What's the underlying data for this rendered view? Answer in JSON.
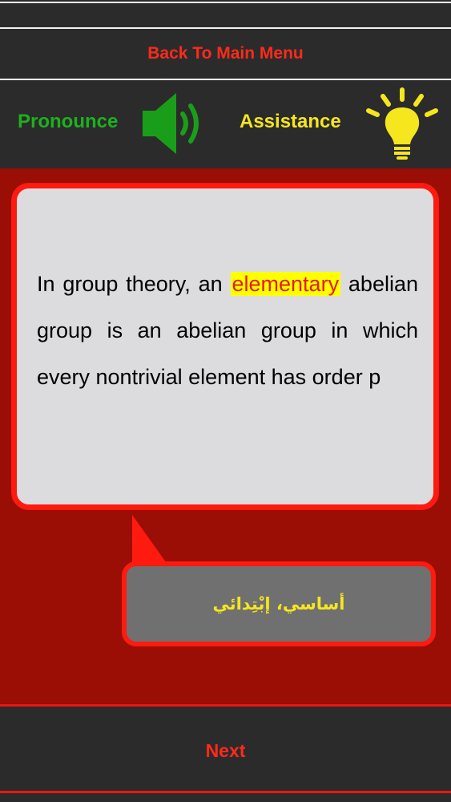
{
  "nav": {
    "back_label": "Back To Main Menu"
  },
  "toolbar": {
    "pronounce_label": "Pronounce",
    "assistance_label": "Assistance",
    "pronounce_icon": "speaker-icon",
    "assistance_icon": "lightbulb-icon"
  },
  "question": {
    "before": "In group theory, an ",
    "highlight": "elementary",
    "after": " abelian group is an abelian group in which every nontrivial element has order p"
  },
  "answer": {
    "text": "أساسي، إبْتِدائي"
  },
  "footer": {
    "next_label": "Next"
  },
  "colors": {
    "accent_red": "#ff2a1a",
    "pronounce_green": "#1db11d",
    "assistance_yellow": "#f5e61e",
    "background_dark": "#2b2b2b",
    "panel_red": "#9a0e06",
    "highlight": "#ffff00"
  }
}
